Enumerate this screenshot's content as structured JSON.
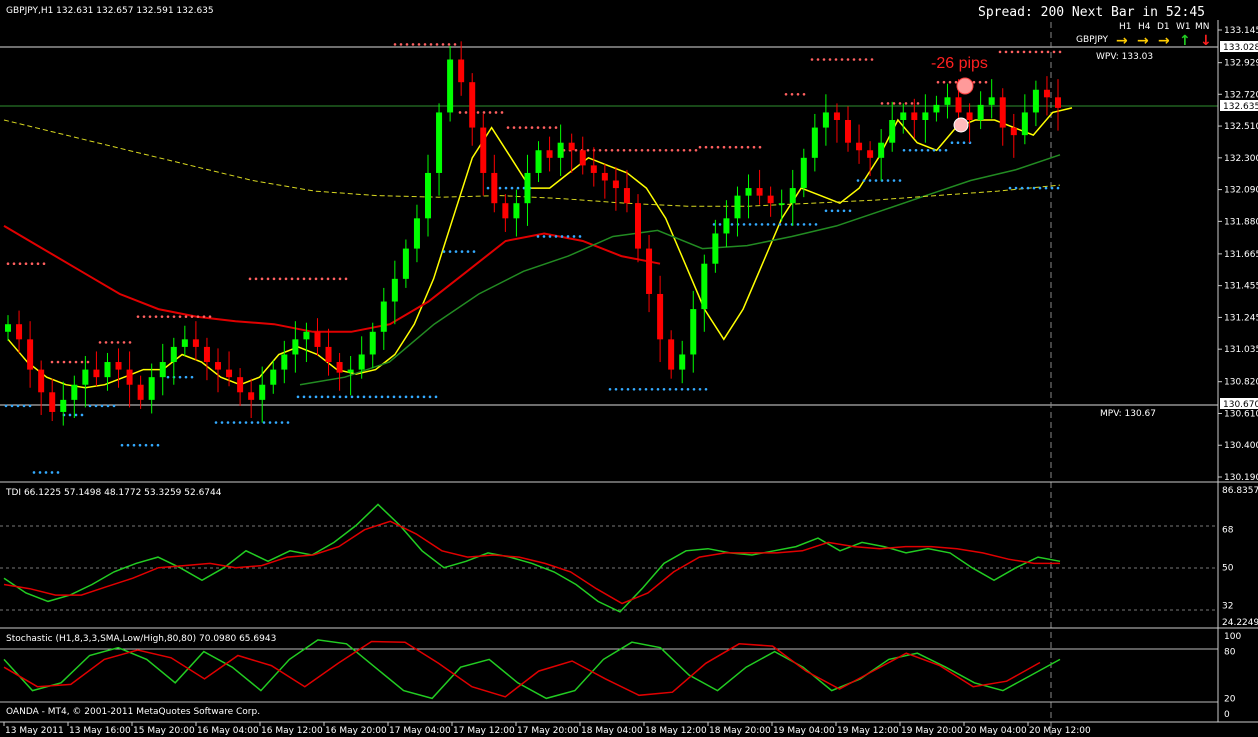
{
  "main": {
    "header": "GBPJPY,H1  132.631 132.657 132.591 132.635",
    "spread": "Spread: 200 Next Bar in 52:45",
    "tf_labels": [
      "H1",
      "H4",
      "D1",
      "W1",
      "MN"
    ],
    "pair_label": "GBPJPY",
    "wpv": "WPV: 133.03",
    "mpv": "MPV: 130.67",
    "annotation": "-26 pips",
    "price_ticks": [
      "133.145",
      "132.929",
      "132.720",
      "132.510",
      "132.300",
      "132.090",
      "131.880",
      "131.665",
      "131.455",
      "131.245",
      "131.035",
      "130.820",
      "130.610",
      "130.400",
      "130.190"
    ],
    "tag_top": "133.028",
    "tag_current": "132.635",
    "tag_bottom": "130.670"
  },
  "tdi": {
    "header": "TDI 66.1225 57.1498 48.1772 53.3259 52.6744",
    "ticks": [
      "86.8357",
      "68",
      "50",
      "32",
      "24.2249"
    ]
  },
  "stoch": {
    "header": "Stochastic (H1,8,3,3,SMA,Low/High,80,80) 70.0980 65.6943",
    "ticks": [
      "100",
      "80",
      "20",
      "0"
    ]
  },
  "footer": {
    "copyright": "OANDA - MT4, © 2001-2011 MetaQuotes Software Corp."
  },
  "time_axis": [
    "13 May 2011",
    "13 May 16:00",
    "15 May 20:00",
    "16 May 04:00",
    "16 May 12:00",
    "16 May 20:00",
    "17 May 04:00",
    "17 May 12:00",
    "17 May 20:00",
    "18 May 04:00",
    "18 May 12:00",
    "18 May 20:00",
    "19 May 04:00",
    "19 May 12:00",
    "19 May 20:00",
    "20 May 04:00",
    "20 May 12:00"
  ],
  "colors": {
    "bull": "#00ff00",
    "bear": "#ff0000",
    "ma_fast": "#ffff00",
    "ma_slow": "#e00000",
    "ma_mid": "#228b22",
    "dot_top": "#ff6060",
    "dot_bottom": "#33aaff"
  },
  "chart_data": [
    {
      "type": "candlestick",
      "title": "GBPJPY,H1",
      "ylim": [
        130.19,
        133.145
      ],
      "series": [
        {
          "name": "price",
          "values": [
            131.2,
            131.1,
            130.9,
            130.75,
            130.62,
            130.7,
            130.8,
            130.9,
            130.85,
            130.95,
            130.9,
            130.8,
            130.7,
            130.85,
            130.95,
            131.05,
            131.1,
            131.05,
            130.95,
            130.9,
            130.85,
            130.75,
            130.7,
            130.8,
            130.9,
            131.0,
            131.1,
            131.15,
            131.05,
            130.95,
            130.88,
            130.9,
            131.0,
            131.15,
            131.35,
            131.5,
            131.7,
            131.9,
            132.2,
            132.6,
            132.95,
            132.8,
            132.5,
            132.2,
            132.0,
            131.9,
            132.0,
            132.2,
            132.35,
            132.3,
            132.4,
            132.35,
            132.25,
            132.2,
            132.15,
            132.1,
            132.0,
            131.7,
            131.4,
            131.1,
            130.9,
            131.0,
            131.3,
            131.6,
            131.8,
            131.9,
            132.05,
            132.1,
            132.05,
            132.0,
            132.0,
            132.1,
            132.3,
            132.5,
            132.6,
            132.55,
            132.4,
            132.35,
            132.3,
            132.4,
            132.55,
            132.6,
            132.55,
            132.6,
            132.65,
            132.7,
            132.6,
            132.55,
            132.65,
            132.7,
            132.5,
            132.45,
            132.6,
            132.75,
            132.7,
            132.63
          ]
        },
        {
          "name": "MA fast (yellow)",
          "values": [
            131.1,
            130.95,
            130.85,
            130.8,
            130.78,
            130.8,
            130.85,
            130.9,
            130.9,
            131.0,
            130.95,
            130.85,
            130.8,
            130.85,
            131.0,
            131.05,
            131.0,
            130.9,
            130.87,
            130.9,
            131.0,
            131.2,
            131.5,
            131.9,
            132.3,
            132.5,
            132.3,
            132.1,
            132.1,
            132.2,
            132.3,
            132.25,
            132.2,
            132.1,
            131.9,
            131.6,
            131.3,
            131.1,
            131.3,
            131.6,
            131.9,
            132.1,
            132.05,
            132.0,
            132.1,
            132.3,
            132.55,
            132.4,
            132.35,
            132.5,
            132.55,
            132.55,
            132.5,
            132.45,
            132.6,
            132.63
          ]
        },
        {
          "name": "MA slow (red)",
          "values": [
            131.85,
            131.7,
            131.55,
            131.4,
            131.3,
            131.25,
            131.22,
            131.2,
            131.15,
            131.15,
            131.2,
            131.35,
            131.55,
            131.75,
            131.8,
            131.75,
            131.65,
            131.6
          ]
        },
        {
          "name": "MA mid (green)",
          "values": [
            130.8,
            130.85,
            130.95,
            131.2,
            131.4,
            131.55,
            131.65,
            131.78,
            131.82,
            131.7,
            131.72,
            131.78,
            131.85,
            131.95,
            132.05,
            132.15,
            132.22,
            132.32
          ]
        }
      ]
    },
    {
      "type": "line",
      "title": "TDI",
      "ylim": [
        24.2249,
        86.8357
      ],
      "series": [
        {
          "name": "TDI green",
          "values": [
            45,
            38,
            34,
            37,
            42,
            48,
            52,
            55,
            50,
            44,
            50,
            58,
            53,
            58,
            56,
            62,
            70,
            80,
            70,
            58,
            50,
            53,
            57,
            55,
            52,
            48,
            42,
            34,
            29,
            40,
            52,
            58,
            59,
            57,
            56,
            58,
            60,
            64,
            58,
            62,
            60,
            57,
            59,
            57,
            50,
            44,
            50,
            55,
            53
          ]
        },
        {
          "name": "TDI red",
          "values": [
            42,
            40,
            37,
            37,
            41,
            45,
            50,
            51,
            52,
            50,
            51,
            55,
            56,
            60,
            68,
            72,
            66,
            58,
            55,
            56,
            55,
            52,
            48,
            40,
            33,
            38,
            48,
            55,
            57,
            57,
            57,
            58,
            62,
            60,
            59,
            60,
            60,
            59,
            57,
            54,
            52,
            52
          ]
        }
      ]
    },
    {
      "type": "line",
      "title": "Stochastic (H1,8,3,3,SMA,Low/High,80,80)",
      "ylim": [
        0,
        100
      ],
      "series": [
        {
          "name": "%K",
          "values": [
            70,
            30,
            40,
            75,
            85,
            70,
            40,
            80,
            60,
            30,
            70,
            95,
            90,
            60,
            30,
            20,
            60,
            70,
            40,
            20,
            30,
            70,
            92,
            85,
            50,
            30,
            60,
            80,
            60,
            30,
            45,
            70,
            78,
            60,
            40,
            30,
            50,
            70
          ]
        },
        {
          "name": "%D",
          "values": [
            60,
            35,
            38,
            70,
            82,
            72,
            45,
            75,
            62,
            35,
            65,
            93,
            92,
            65,
            35,
            22,
            55,
            68,
            45,
            24,
            28,
            65,
            90,
            87,
            55,
            32,
            55,
            78,
            62,
            35,
            42,
            66
          ]
        }
      ]
    }
  ]
}
